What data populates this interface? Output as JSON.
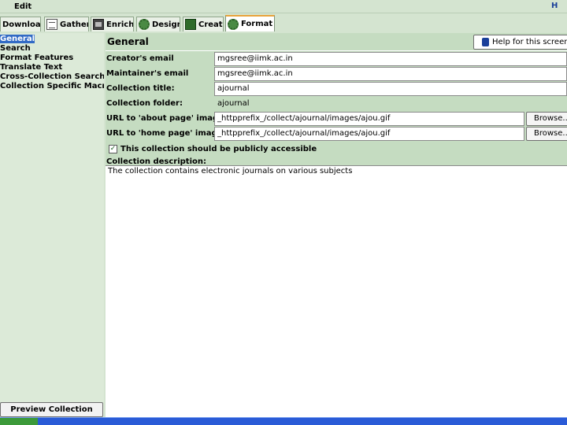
{
  "menubar": {
    "edit": "Edit",
    "help_glyph": "H"
  },
  "tabs": [
    {
      "label": "Download",
      "icon": "download-icon",
      "active": false
    },
    {
      "label": "Gather",
      "icon": "gather-icon",
      "active": false
    },
    {
      "label": "Enrich",
      "icon": "enrich-icon",
      "active": false
    },
    {
      "label": "Design",
      "icon": "design-gear-icon",
      "active": false
    },
    {
      "label": "Create",
      "icon": "create-icon",
      "active": false
    },
    {
      "label": "Format",
      "icon": "format-gear-icon",
      "active": true
    }
  ],
  "sidebar": {
    "items": [
      {
        "label": "General",
        "selected": true
      },
      {
        "label": "Search",
        "selected": false
      },
      {
        "label": "Format Features",
        "selected": false
      },
      {
        "label": "Translate Text",
        "selected": false
      },
      {
        "label": "Cross-Collection Search",
        "selected": false
      },
      {
        "label": "Collection Specific Macros",
        "selected": false
      }
    ],
    "preview_button": "Preview Collection"
  },
  "main": {
    "title": "General",
    "help_button": "Help for this screen",
    "fields": {
      "creator_email": {
        "label": "Creator's email",
        "value": "mgsree@iimk.ac.in"
      },
      "maintainer_email": {
        "label": "Maintainer's email",
        "value": "mgsree@iimk.ac.in"
      },
      "collection_title": {
        "label": "Collection title:",
        "value": "ajournal"
      },
      "collection_folder": {
        "label": "Collection folder:",
        "value": "ajournal"
      },
      "about_image": {
        "label": "URL to 'about page' image:",
        "value": "_httpprefix_/collect/ajournal/images/ajou.gif",
        "browse": "Browse..."
      },
      "home_image": {
        "label": "URL to 'home page' image:",
        "value": "_httpprefix_/collect/ajournal/images/ajou.gif",
        "browse": "Browse..."
      }
    },
    "public_checkbox": {
      "label": "This collection should be publicly accessible",
      "checked": true,
      "mark": "✓"
    },
    "description": {
      "label": "Collection description:",
      "value": "The collection contains electronic journals on various subjects"
    }
  },
  "colors": {
    "background": "#d4e4d0",
    "panel": "#c5dcc1",
    "selection": "#316ac5",
    "taskbar": "#2a5bd7"
  }
}
